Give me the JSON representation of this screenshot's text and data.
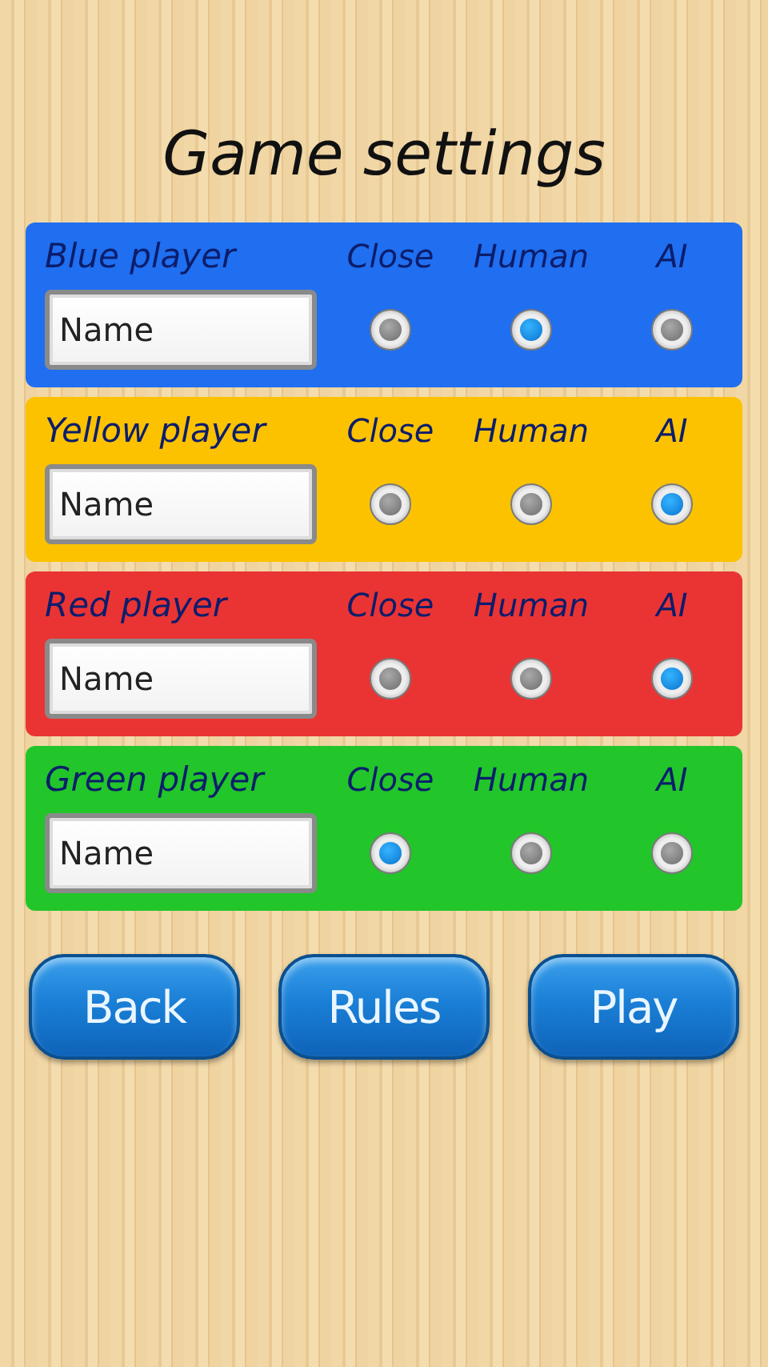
{
  "title": "Game settings",
  "players": [
    {
      "label": "Blue player",
      "color": "#1f6ff0",
      "name_value": "Name",
      "options": [
        {
          "label": "Close",
          "selected": false
        },
        {
          "label": "Human",
          "selected": true
        },
        {
          "label": "AI",
          "selected": false
        }
      ]
    },
    {
      "label": "Yellow player",
      "color": "#fcc200",
      "name_value": "Name",
      "options": [
        {
          "label": "Close",
          "selected": false
        },
        {
          "label": "Human",
          "selected": false
        },
        {
          "label": "AI",
          "selected": true
        }
      ]
    },
    {
      "label": "Red player",
      "color": "#ea3434",
      "name_value": "Name",
      "options": [
        {
          "label": "Close",
          "selected": false
        },
        {
          "label": "Human",
          "selected": false
        },
        {
          "label": "AI",
          "selected": true
        }
      ]
    },
    {
      "label": "Green player",
      "color": "#22c52a",
      "name_value": "Name",
      "options": [
        {
          "label": "Close",
          "selected": true
        },
        {
          "label": "Human",
          "selected": false
        },
        {
          "label": "AI",
          "selected": false
        }
      ]
    }
  ],
  "buttons": [
    "Back",
    "Rules",
    "Play"
  ]
}
